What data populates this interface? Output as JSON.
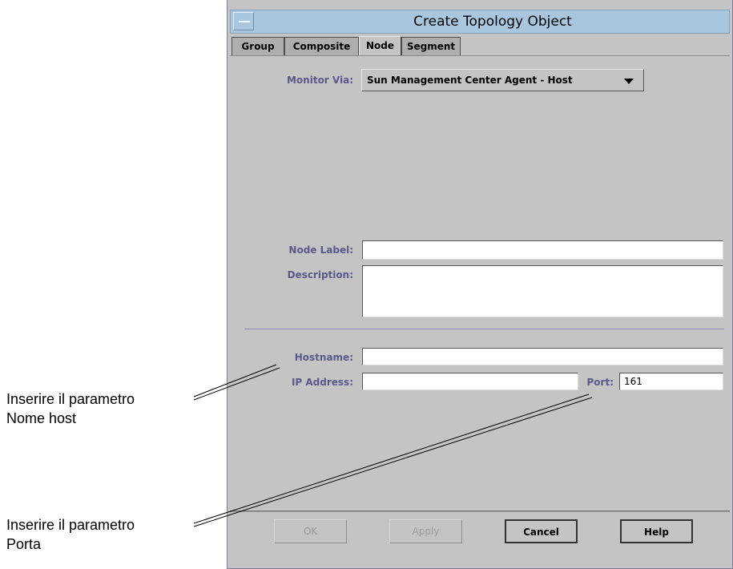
{
  "window": {
    "title": "Create Topology Object",
    "tabs": [
      {
        "label": "Group",
        "active": false
      },
      {
        "label": "Composite",
        "active": false
      },
      {
        "label": "Node",
        "active": true
      },
      {
        "label": "Segment",
        "active": false
      }
    ]
  },
  "form": {
    "monitor_via_label": "Monitor Via:",
    "monitor_via_value": "Sun Management Center Agent - Host",
    "node_label_label": "Node Label:",
    "node_label_value": "",
    "description_label": "Description:",
    "description_value": "",
    "hostname_label": "Hostname:",
    "hostname_value": "",
    "ip_address_label": "IP Address:",
    "ip_address_value": "",
    "port_label": "Port:",
    "port_value": "161"
  },
  "buttons": {
    "ok": "OK",
    "apply": "Apply",
    "cancel": "Cancel",
    "help": "Help"
  },
  "callouts": {
    "hostname_line1": "Inserire il parametro",
    "hostname_line2": "Nome host",
    "port_line1": "Inserire il parametro",
    "port_line2": "Porta"
  },
  "icons": {
    "window_menu": "window-menu-icon",
    "dropdown": "chevron-down-icon"
  }
}
